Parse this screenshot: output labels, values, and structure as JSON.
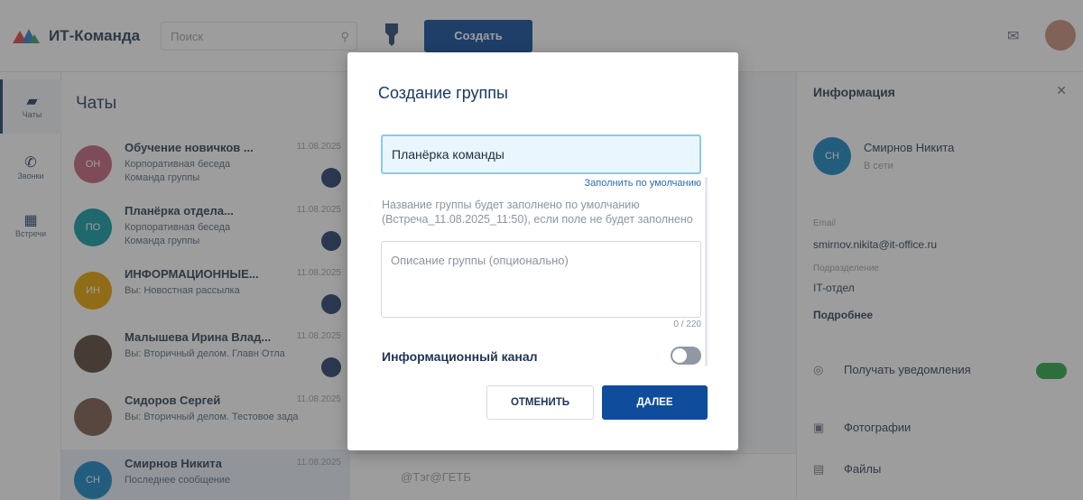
{
  "app": {
    "name": "ИТ-Команда",
    "search_placeholder": "Поиск",
    "create_button": "Создать"
  },
  "rail": {
    "items": [
      {
        "label": "Чаты",
        "icon": "chat-icon"
      },
      {
        "label": "Звонки",
        "icon": "phone-icon"
      },
      {
        "label": "Встречи",
        "icon": "calendar-icon"
      }
    ]
  },
  "chat_list": {
    "title": "Чаты",
    "items": [
      {
        "name": "Обучение новичков ...",
        "date": "11.08.2025",
        "line1": "Корпоративная беседа",
        "line2": "Команда группы",
        "avatar_text": "ОН",
        "avatar_color": "#c2647c"
      },
      {
        "name": "Планёрка отдела...",
        "date": "11.08.2025",
        "line1": "Корпоративная беседа",
        "line2": "Команда группы",
        "avatar_text": "ПО",
        "avatar_color": "#0f9aa3"
      },
      {
        "name": "ИНФОРМАЦИОННЫЕ...",
        "date": "11.08.2025",
        "line1": "Вы: Новостная рассылка",
        "line2": "",
        "avatar_text": "ИН",
        "avatar_color": "#e6a200"
      },
      {
        "name": "Малышева Ирина Влад...",
        "date": "11.08.2025",
        "line1": "Вы: Вторичный делом. Главн Отла",
        "line2": "",
        "avatar_text": "",
        "avatar_color": "#5a4638"
      },
      {
        "name": "Сидоров Сергей",
        "date": "11.08.2025",
        "line1": "Вы: Вторичный делом. Тестовое зада",
        "line2": "",
        "avatar_text": "",
        "avatar_color": "#7a5a4a"
      },
      {
        "name": "Смирнов Никита",
        "date": "11.08.2025",
        "line1": "Последнее сообщение",
        "line2": "",
        "avatar_text": "СН",
        "avatar_color": "#1584c4"
      }
    ]
  },
  "message_box": {
    "placeholder": "@Тэг@ГЕТБ"
  },
  "right_pane": {
    "title": "Информация",
    "contact_name": "Смирнов Никита",
    "contact_status": "В сети",
    "avatar_text": "СН",
    "email_label": "Email",
    "email_value": "smirnov.nikita@it-office.ru",
    "dept_label": "Подразделение",
    "dept_value": "IT-отдел",
    "more": "Подробнее",
    "rows": [
      {
        "label": "Получать уведомления",
        "icon": "bell-icon"
      },
      {
        "label": "Фотографии",
        "icon": "photo-icon"
      },
      {
        "label": "Файлы",
        "icon": "file-icon"
      }
    ]
  },
  "modal": {
    "title": "Создание группы",
    "name_value": "Планёрка команды",
    "fill_default_link": "Заполнить по умолчанию",
    "hint": "Название группы будет заполнено по умолчанию (Встреча_11.08.2025_11:50), если поле не будет заполнено",
    "description_placeholder": "Описание группы (опционально)",
    "description_value": "",
    "counter": "0 / 220",
    "info_channel_label": "Информационный канал",
    "info_channel_enabled": false,
    "cancel_label": "ОТМЕНИТЬ",
    "next_label": "ДАЛЕЕ"
  },
  "colors": {
    "primary": "#0f4c9c",
    "title": "#183a63",
    "input_focus_bg": "#e9f6fd",
    "input_focus_border": "#8cc8ee",
    "toggle_off": "#8f98a3",
    "link": "#2a6bb5"
  }
}
